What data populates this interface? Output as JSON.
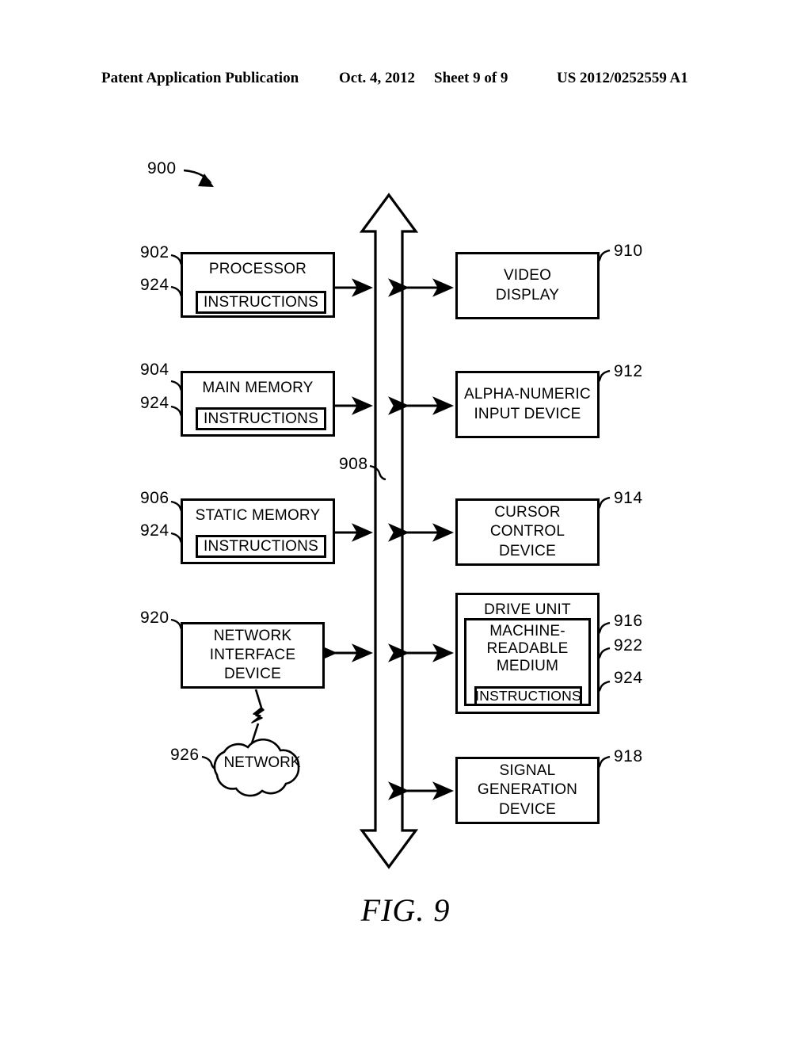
{
  "header": {
    "publication": "Patent Application Publication",
    "date": "Oct. 4, 2012",
    "sheet": "Sheet 9 of 9",
    "pub_number": "US 2012/0252559 A1"
  },
  "figure": {
    "caption": "FIG. 9",
    "system_ref": "900",
    "bus_ref": "908"
  },
  "left_column": [
    {
      "ref": "902",
      "title": "PROCESSOR",
      "inner_ref": "924",
      "inner_label": "INSTRUCTIONS"
    },
    {
      "ref": "904",
      "title": "MAIN MEMORY",
      "inner_ref": "924",
      "inner_label": "INSTRUCTIONS"
    },
    {
      "ref": "906",
      "title": "STATIC MEMORY",
      "inner_ref": "924",
      "inner_label": "INSTRUCTIONS"
    },
    {
      "ref": "920",
      "title": "NETWORK INTERFACE DEVICE",
      "line1": "NETWORK",
      "line2": "INTERFACE",
      "line3": "DEVICE"
    }
  ],
  "right_column": [
    {
      "ref": "910",
      "line1": "VIDEO",
      "line2": "DISPLAY"
    },
    {
      "ref": "912",
      "line1": "ALPHA-NUMERIC",
      "line2": "INPUT DEVICE"
    },
    {
      "ref": "914",
      "line1": "CURSOR",
      "line2": "CONTROL",
      "line3": "DEVICE"
    },
    {
      "ref": "918",
      "line1": "SIGNAL",
      "line2": "GENERATION",
      "line3": "DEVICE"
    }
  ],
  "drive_unit": {
    "ref": "916",
    "title": "DRIVE UNIT",
    "medium_ref": "922",
    "medium_line1": "MACHINE-",
    "medium_line2": "READABLE",
    "medium_line3": "MEDIUM",
    "instructions_ref": "924",
    "instructions_label": "INSTRUCTIONS"
  },
  "network": {
    "ref": "926",
    "label": "NETWORK"
  },
  "colors": {
    "ink": "#000000",
    "paper": "#ffffff"
  }
}
